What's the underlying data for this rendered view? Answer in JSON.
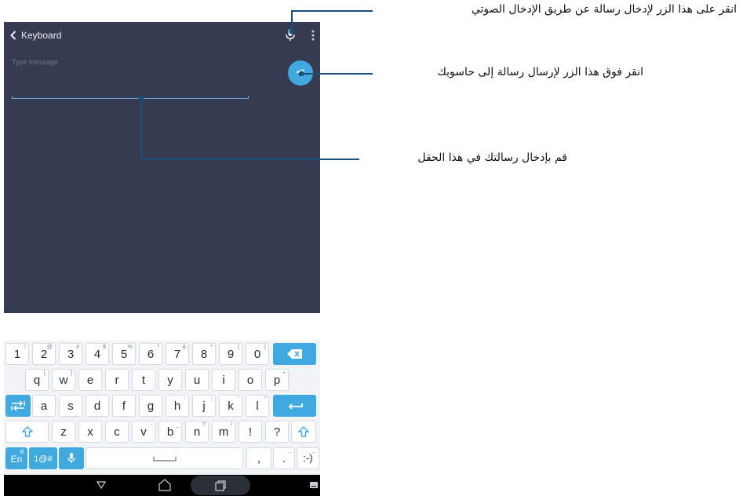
{
  "app": {
    "title": "Keyboard",
    "back_icon": "chevron-left-icon",
    "mic_icon": "microphone-icon",
    "overflow_icon": "more-vert-icon"
  },
  "message": {
    "placeholder": "Type message",
    "send_icon": "send-icon"
  },
  "keyboard": {
    "row1": [
      {
        "main": "1",
        "hint": "!"
      },
      {
        "main": "2",
        "hint": "@"
      },
      {
        "main": "3",
        "hint": "#"
      },
      {
        "main": "4",
        "hint": "$"
      },
      {
        "main": "5",
        "hint": "%"
      },
      {
        "main": "6",
        "hint": "^"
      },
      {
        "main": "7",
        "hint": "&"
      },
      {
        "main": "8",
        "hint": "*"
      },
      {
        "main": "9",
        "hint": "("
      },
      {
        "main": "0",
        "hint": ")"
      }
    ],
    "row2": [
      {
        "main": "q",
        "hint": "["
      },
      {
        "main": "w",
        "hint": "]"
      },
      {
        "main": "e",
        "hint": ""
      },
      {
        "main": "r",
        "hint": ""
      },
      {
        "main": "t",
        "hint": ""
      },
      {
        "main": "y",
        "hint": ""
      },
      {
        "main": "u",
        "hint": ""
      },
      {
        "main": "i",
        "hint": ""
      },
      {
        "main": "o",
        "hint": ""
      },
      {
        "main": "p",
        "hint": "+"
      }
    ],
    "row3": [
      {
        "main": "a",
        "hint": ""
      },
      {
        "main": "s",
        "hint": ""
      },
      {
        "main": "d",
        "hint": ""
      },
      {
        "main": "f",
        "hint": ""
      },
      {
        "main": "g",
        "hint": ""
      },
      {
        "main": "h",
        "hint": ":"
      },
      {
        "main": "j",
        "hint": ";"
      },
      {
        "main": "k",
        "hint": "'"
      },
      {
        "main": "l",
        "hint": "\""
      }
    ],
    "row4": [
      {
        "main": "z",
        "hint": ""
      },
      {
        "main": "x",
        "hint": ""
      },
      {
        "main": "c",
        "hint": ""
      },
      {
        "main": "v",
        "hint": "-"
      },
      {
        "main": "b",
        "hint": "_"
      },
      {
        "main": "n",
        "hint": "?"
      },
      {
        "main": "m",
        "hint": "/"
      },
      {
        "main": "!",
        "hint": ""
      },
      {
        "main": "?",
        "hint": ""
      }
    ],
    "lang_label": "En",
    "lang_hint": "⚙",
    "symbols_label": "1@#",
    "comma": ",",
    "period": ".",
    "period_hint": "...",
    "smiley": ":-)",
    "smiley_hint": "..."
  },
  "annotations": {
    "mic": "انقر على هذا الزر لإدخال رسالة عن طريق الإدخال الصوتي",
    "send": "انقر فوق هذا الزر لإرسال رسالة إلى حاسوبك",
    "field": "قم بإدخال رسالتك في هذا الحقل"
  }
}
